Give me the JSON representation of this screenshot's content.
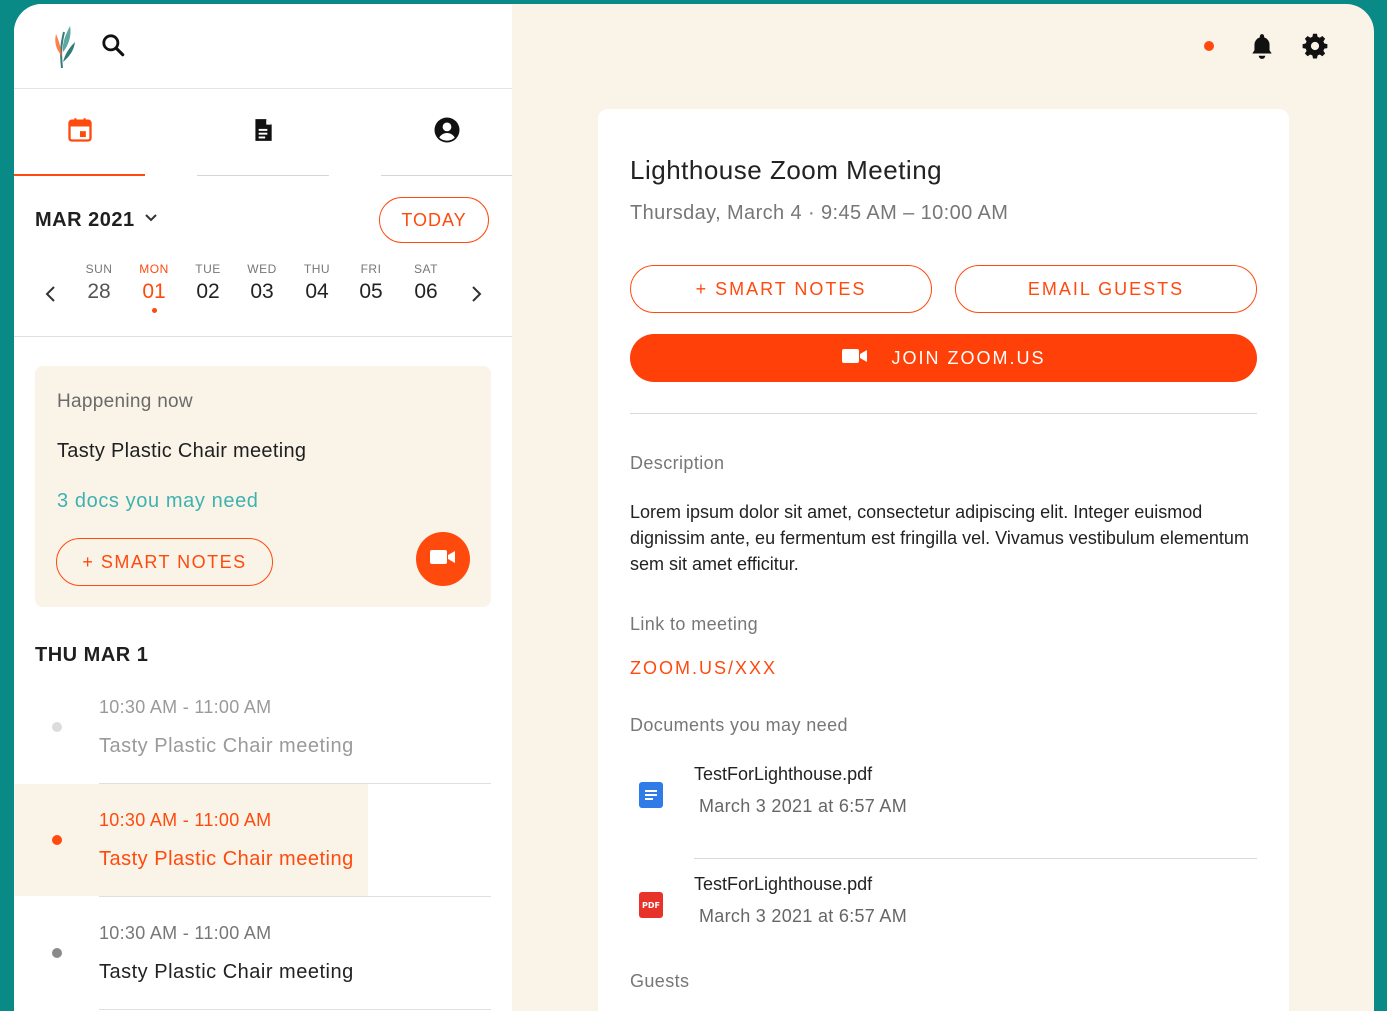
{
  "colors": {
    "accent": "#ff4a0e",
    "teal": "#3fb2b0",
    "cream": "#faf3e8",
    "frame_bg": "#0a8a86"
  },
  "header": {
    "logo_icon": "feather-logo-icon",
    "search_icon": "search-icon",
    "notification_icon": "bell-icon",
    "settings_icon": "gear-icon"
  },
  "tabs": [
    {
      "name": "calendar",
      "icon": "calendar-icon",
      "active": true
    },
    {
      "name": "documents",
      "icon": "document-icon",
      "active": false
    },
    {
      "name": "profile",
      "icon": "account-circle-icon",
      "active": false
    }
  ],
  "calendar": {
    "month_label": "MAR 2021",
    "today_label": "TODAY",
    "days": [
      {
        "dow": "SUN",
        "num": "28"
      },
      {
        "dow": "MON",
        "num": "01"
      },
      {
        "dow": "TUE",
        "num": "02"
      },
      {
        "dow": "WED",
        "num": "03"
      },
      {
        "dow": "THU",
        "num": "04"
      },
      {
        "dow": "FRI",
        "num": "05"
      },
      {
        "dow": "SAT",
        "num": "06"
      }
    ],
    "selected_day": "01"
  },
  "now": {
    "label": "Happening now",
    "title": "Tasty Plastic Chair meeting",
    "docs": "3 docs you may need",
    "smart_notes": "+ SMART NOTES"
  },
  "day_header": "THU MAR 1",
  "events": [
    {
      "time": "10:30 AM - 11:00 AM",
      "title": "Tasty Plastic Chair meeting",
      "state": "past"
    },
    {
      "time": "10:30 AM - 11:00 AM",
      "title": "Tasty Plastic Chair meeting",
      "state": "selected"
    },
    {
      "time": "10:30 AM - 11:00 AM",
      "title": "Tasty Plastic Chair meeting",
      "state": "upcoming"
    }
  ],
  "detail": {
    "title": "Lighthouse Zoom Meeting",
    "time": "Thursday, March 4 · 9:45 AM – 10:00 AM",
    "smart_notes": "+ SMART NOTES",
    "email_guests": "EMAIL GUESTS",
    "join": "JOIN ZOOM.US",
    "description_label": "Description",
    "description": "Lorem ipsum dolor sit amet, consectetur adipiscing elit. Integer euismod dignissim ante, eu fermentum est fringilla vel. Vivamus vestibulum elementum sem sit amet efficitur.",
    "link_label": "Link to meeting",
    "link": "ZOOM.US/XXX",
    "docs_label": "Documents you may need",
    "documents": [
      {
        "name": "TestForLighthouse.pdf",
        "date": "March 3 2021 at 6:57 AM",
        "icon": "google-doc-icon"
      },
      {
        "name": "TestForLighthouse.pdf",
        "date": "March 3 2021 at 6:57 AM",
        "icon": "pdf-icon",
        "badge": "PDF"
      }
    ],
    "guests_label": "Guests"
  }
}
